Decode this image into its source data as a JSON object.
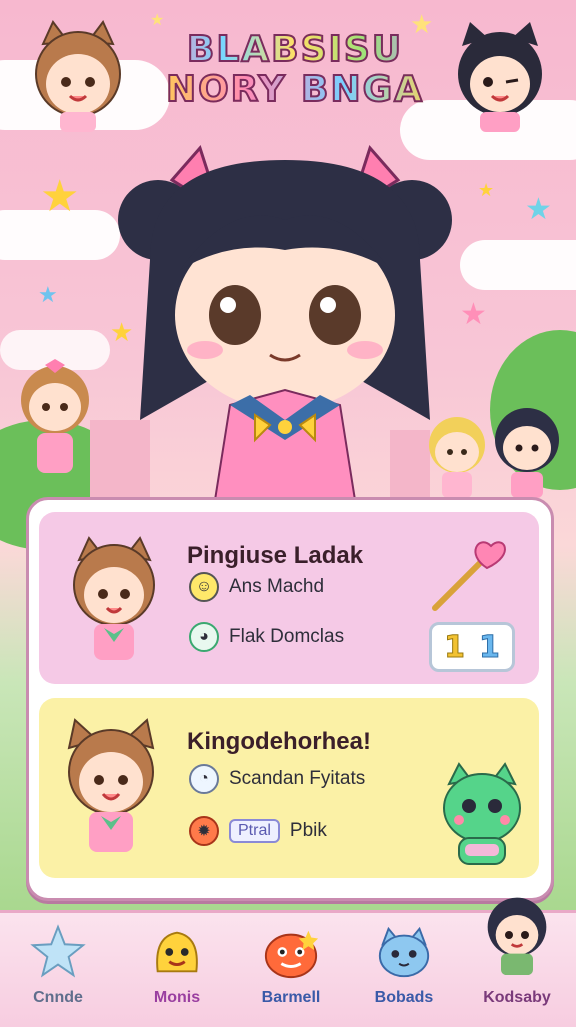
{
  "game": {
    "title_line1": "BLABSISU",
    "title_line2": "NORY BNGA"
  },
  "cards": [
    {
      "title": "Pingiuse Ladak",
      "rows": [
        {
          "icon": "smiley-icon",
          "text": "Ans Machd"
        },
        {
          "icon": "ghost-icon",
          "text": "Flak Domclas"
        }
      ],
      "score": {
        "left": "1",
        "right": "1"
      }
    },
    {
      "title": "Kingodehorhea!",
      "rows": [
        {
          "icon": "ghost-icon",
          "text": "Scandan Fyitats"
        },
        {
          "icon": "fire-creature-icon",
          "tag": "Ptral",
          "text": "Pbik"
        }
      ]
    }
  ],
  "nav": [
    {
      "label": "Cnnde",
      "icon": "star-icon",
      "color": "#5f6e8c"
    },
    {
      "label": "Monis",
      "icon": "yellow-monster-icon",
      "color": "#9a3fa0"
    },
    {
      "label": "Barmell",
      "icon": "orange-monster-icon",
      "color": "#3a5aa8"
    },
    {
      "label": "Bobads",
      "icon": "blue-cat-icon",
      "color": "#3a5aa8"
    },
    {
      "label": "Kodsaby",
      "icon": "girl-avatar-icon",
      "color": "#7a3a7a"
    }
  ],
  "colors": {
    "accent_pink": "#f5c9e6",
    "accent_yellow": "#fbf1a6",
    "border": "#c98cb0"
  }
}
